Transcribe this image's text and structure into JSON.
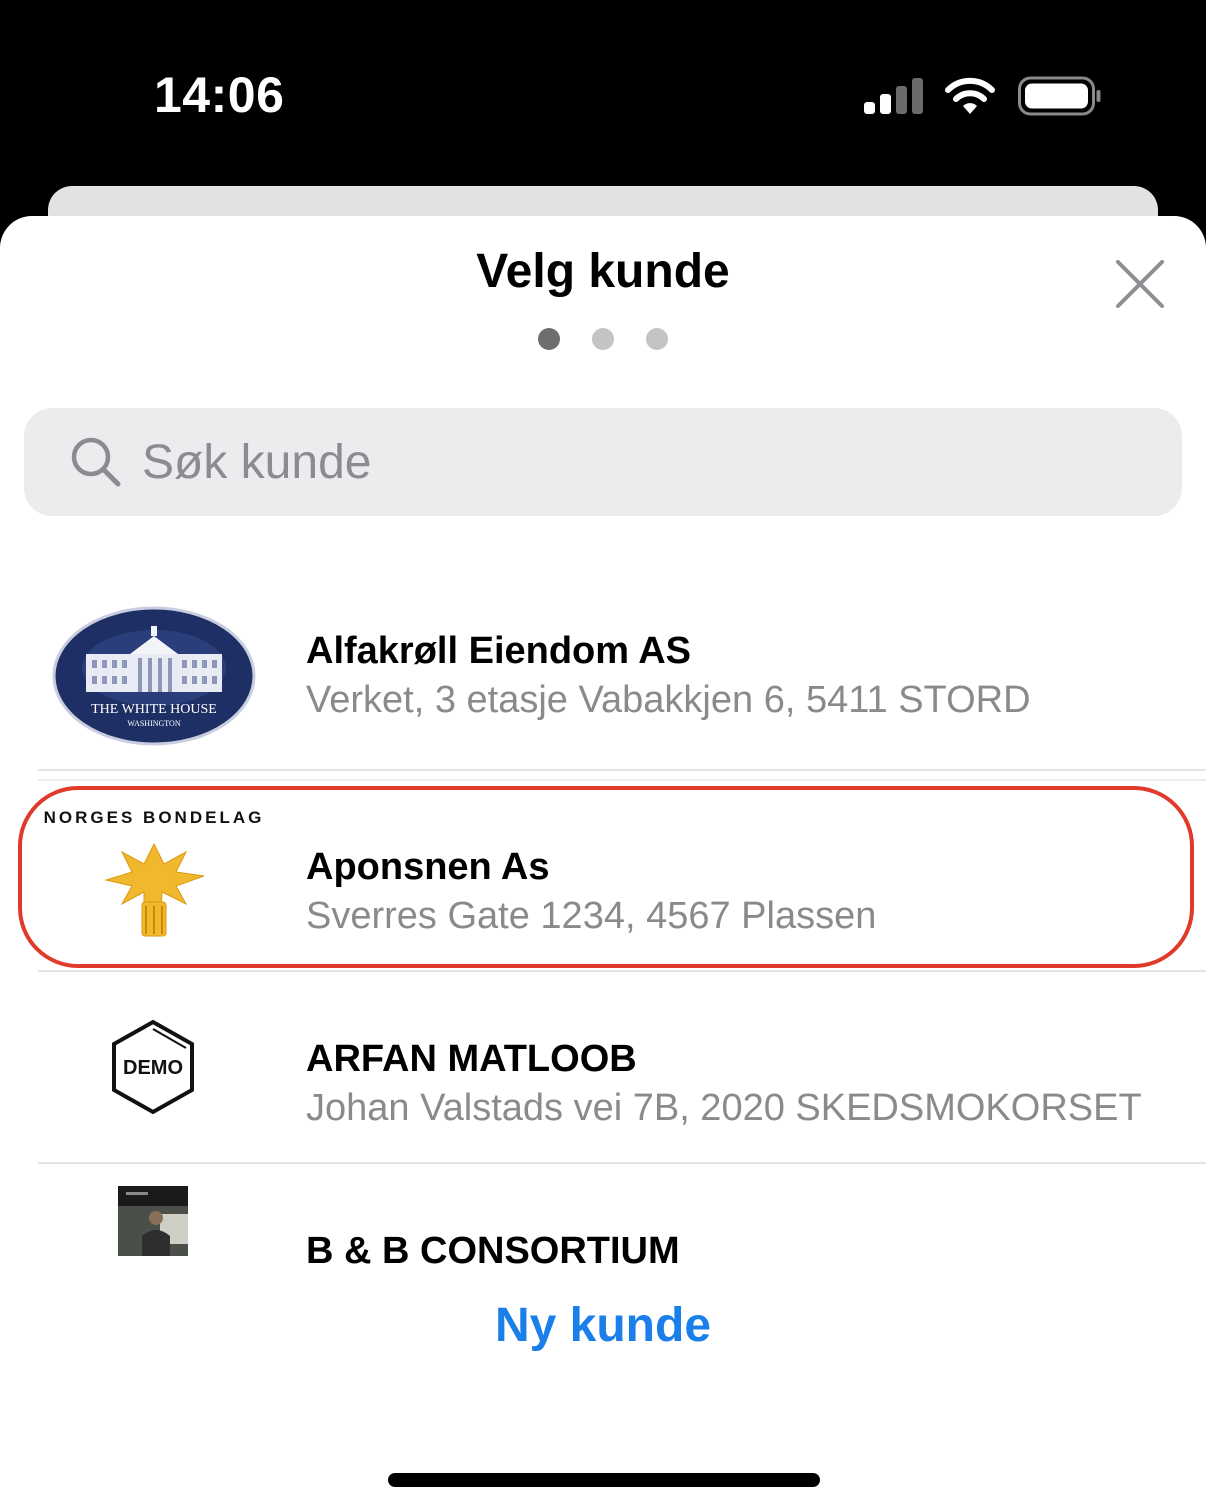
{
  "status_bar": {
    "time": "14:06"
  },
  "sheet": {
    "title": "Velg kunde",
    "page_dots": {
      "count": 3,
      "active_index": 0
    }
  },
  "search": {
    "placeholder": "Søk kunde",
    "value": ""
  },
  "customers": [
    {
      "name": "Alfakrøll Eiendom AS",
      "address": "Verket, 3 etasje Vabakkjen 6, 5411 STORD",
      "logo": "white-house-seal-logo",
      "logo_text": "THE WHITE HOUSE",
      "logo_subtext": "WASHINGTON"
    },
    {
      "name": "Aponsnen As",
      "address": "Sverres Gate 1234, 4567 Plassen",
      "logo": "norges-bondelag-logo",
      "logo_text": "NORGES BONDELAG",
      "highlighted": true
    },
    {
      "name": "ARFAN MATLOOB",
      "address": "Johan Valstads vei 7B, 2020 SKEDSMOKORSET",
      "logo": "demo-hexagon-logo",
      "logo_text": "DEMO"
    },
    {
      "name": "B & B CONSORTIUM",
      "address": "",
      "logo": "photo-thumbnail"
    }
  ],
  "actions": {
    "new_customer": "Ny kunde"
  },
  "colors": {
    "accent": "#1a7fe8",
    "highlight": "#e03a2a",
    "secondary_text": "#8a8a8e"
  }
}
